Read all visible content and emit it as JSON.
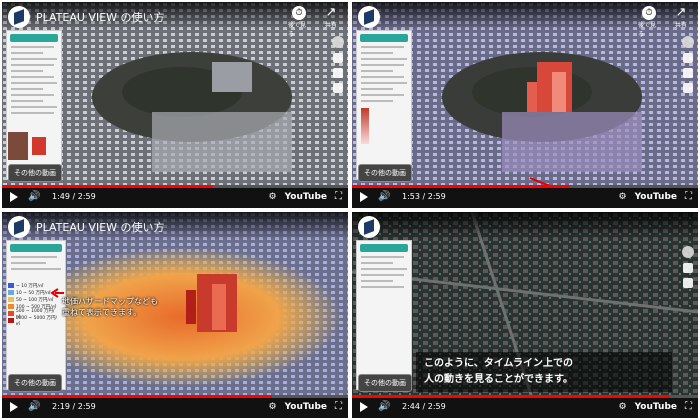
{
  "video_title": "PLATEAU VIEW の使い方",
  "top_icons": {
    "watch_later_label": "後で見る",
    "share_label": "共有",
    "watch_later_glyph": "⏱",
    "share_glyph": "↗"
  },
  "other_videos_label": "その他の動画",
  "youtube_label": "YouTube",
  "panels": [
    {
      "time": "1:49 / 2:59",
      "progress": 0.61
    },
    {
      "time": "1:53 / 2:59",
      "progress": 0.63
    },
    {
      "time": "2:19 / 2:59",
      "progress": 0.78
    },
    {
      "time": "2:44 / 2:59",
      "progress": 0.92
    }
  ],
  "panel3_annotation": [
    "地価ハザードマップなども",
    "重ねて表示できます。"
  ],
  "panel4_caption": [
    "このように、タイムライン上での",
    "人の動きを見ることができます。"
  ],
  "legend": [
    {
      "label": "~ 10 万円/㎡",
      "color": "#3b5bd6"
    },
    {
      "label": "10 ~ 50 万円/㎡",
      "color": "#6fa6e0"
    },
    {
      "label": "50 ~ 100 万円/㎡",
      "color": "#f2c14a"
    },
    {
      "label": "100 ~ 500 万円/㎡",
      "color": "#ef8a2c"
    },
    {
      "label": "500 ~ 1000 万円/㎡",
      "color": "#e24c25"
    },
    {
      "label": "1000 ~ 5000 万円/㎡",
      "color": "#b01818"
    }
  ],
  "colors": {
    "progress": "#ff0000",
    "sidebar_header": "#2aa59a",
    "annotation_red": "#e00000"
  }
}
